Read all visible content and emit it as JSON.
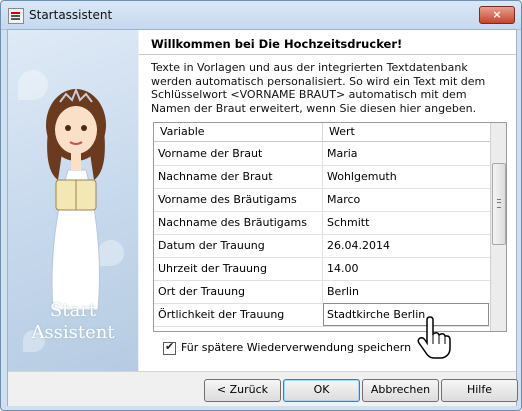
{
  "window": {
    "title": "Startassistent",
    "close_label": "×"
  },
  "sidebar": {
    "label_line1": "Start",
    "label_line2": "Assistent"
  },
  "content": {
    "heading": "Willkommen bei Die Hochzeitsdrucker!",
    "description": "Texte in Vorlagen und aus der integrierten Textdatenbank werden automatisch personalisiert. So wird ein Text mit dem Schlüsselwort <VORNAME BRAUT> automatisch mit dem Namen der Braut erweitert, wenn Sie diesen hier angeben."
  },
  "table": {
    "columns": [
      "Variable",
      "Wert"
    ],
    "rows": [
      {
        "variable": "Vorname der Braut",
        "value": "Maria"
      },
      {
        "variable": "Nachname der Braut",
        "value": "Wohlgemuth"
      },
      {
        "variable": "Vorname des Bräutigams",
        "value": "Marco"
      },
      {
        "variable": "Nachname des Bräutigams",
        "value": "Schmitt"
      },
      {
        "variable": "Datum der Trauung",
        "value": "26.04.2014"
      },
      {
        "variable": "Uhrzeit der Trauung",
        "value": "14.00"
      },
      {
        "variable": "Ort der Trauung",
        "value": "Berlin"
      },
      {
        "variable": "Örtlichkeit der Trauung",
        "value": "Stadtkirche Berlin"
      }
    ]
  },
  "options": {
    "save_checkbox_label": "Für spätere Wiederverwendung speichern",
    "save_checked": true
  },
  "buttons": {
    "back": "< Zurück",
    "ok": "OK",
    "cancel": "Abbrechen",
    "help": "Hilfe"
  },
  "colors": {
    "accent": "#3c7fb1",
    "sidebar_bg": "#c6d8ec"
  }
}
